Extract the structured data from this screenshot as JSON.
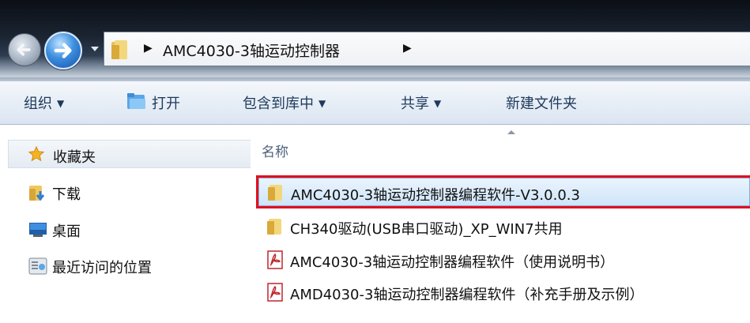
{
  "address_bar": {
    "current_folder": "AMC4030-3轴运动控制器"
  },
  "toolbar": {
    "organize": "组织",
    "open": "打开",
    "include_in_library": "包含到库中",
    "share": "共享",
    "new_folder": "新建文件夹"
  },
  "nav_pane": {
    "favorites": "收藏夹",
    "items": [
      {
        "label": "下载",
        "icon": "download-folder-icon"
      },
      {
        "label": "桌面",
        "icon": "desktop-icon"
      },
      {
        "label": "最近访问的位置",
        "icon": "recent-places-icon"
      }
    ]
  },
  "file_list": {
    "column_name": "名称",
    "files": [
      {
        "name": "AMC4030-3轴运动控制器编程软件-V3.0.0.3",
        "type": "folder",
        "selected": true
      },
      {
        "name": "CH340驱动(USB串口驱动)_XP_WIN7共用",
        "type": "folder",
        "selected": false
      },
      {
        "name": "AMC4030-3轴运动控制器编程软件（使用说明书）",
        "type": "pdf",
        "selected": false
      },
      {
        "name": "AMD4030-3轴运动控制器编程软件（补充手册及示例）",
        "type": "pdf",
        "selected": false
      }
    ]
  },
  "colors": {
    "highlight_box": "#e01020",
    "toolbar_text": "#1e395b",
    "selection": "#cfe5f9"
  }
}
